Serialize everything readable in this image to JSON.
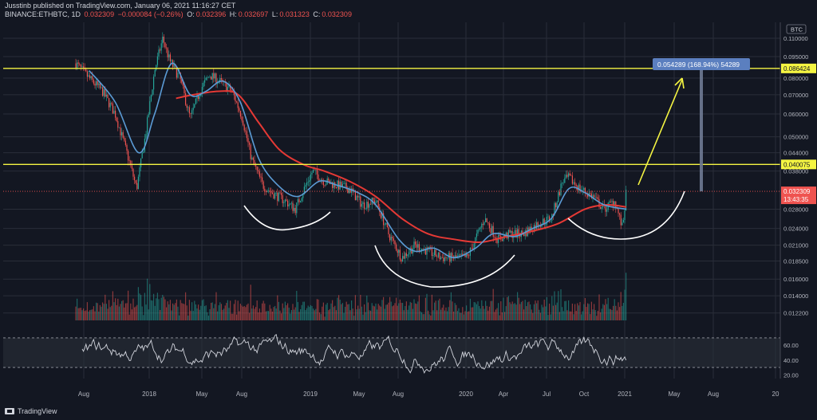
{
  "header": {
    "publisher_line": "Jusstinb published on TradingView.com, January 06, 2021 11:16:27 CET",
    "symbol": "BINANCE:ETHBTC, 1D",
    "last": "0.032309",
    "change": "−0.000084 (−0.26%)",
    "o_label": "O:",
    "o": "0.032396",
    "h_label": "H:",
    "h": "0.032697",
    "l_label": "L:",
    "l": "0.031323",
    "c_label": "C:",
    "c": "0.032309"
  },
  "footer": {
    "brand": "TradingView"
  },
  "colors": {
    "background": "#131722",
    "grid": "#2a2e39",
    "up": "#26a69a",
    "down": "#ef5350",
    "ma_fast": "#5b9bd5",
    "ma_slow": "#e53935",
    "level": "#f5f542",
    "arrow": "#f5f542",
    "curves": "#ffffff",
    "rsi": "#d1d4dc",
    "measure": "#5b7fbf"
  },
  "chart_data": {
    "type": "candlestick",
    "currency_label": "BTC",
    "x_ticks": [
      "Aug",
      "2018",
      "May",
      "Aug",
      "2019",
      "May",
      "Aug",
      "2020",
      "Apr",
      "Jul",
      "Oct",
      "2021",
      "May",
      "Aug",
      "20"
    ],
    "y_axis_log": true,
    "y_ticks": [
      "0.110000",
      "0.095000",
      "0.080000",
      "0.070000",
      "0.060000",
      "0.050000",
      "0.044000",
      "0.038000",
      "0.028000",
      "0.024000",
      "0.021000",
      "0.018500",
      "0.016000",
      "0.014000",
      "0.012200"
    ],
    "y_range": [
      0.0115,
      0.125
    ],
    "horizontal_levels": [
      {
        "price": 0.086424,
        "label": "0.086424"
      },
      {
        "price": 0.040075,
        "label": "0.040075"
      }
    ],
    "last_price": {
      "price": 0.032309,
      "label": "0.032309",
      "countdown": "13:43:35"
    },
    "measure_label": "0.054289 (168.94%) 54289",
    "price_path": [
      [
        "2017-07-01",
        0.09
      ],
      [
        "2017-08-01",
        0.08
      ],
      [
        "2017-09-01",
        0.072
      ],
      [
        "2017-10-01",
        0.06
      ],
      [
        "2017-11-01",
        0.042
      ],
      [
        "2017-11-20",
        0.033
      ],
      [
        "2017-12-10",
        0.05
      ],
      [
        "2018-01-01",
        0.085
      ],
      [
        "2018-01-20",
        0.11
      ],
      [
        "2018-02-05",
        0.092
      ],
      [
        "2018-03-01",
        0.08
      ],
      [
        "2018-03-25",
        0.058
      ],
      [
        "2018-04-20",
        0.074
      ],
      [
        "2018-05-10",
        0.082
      ],
      [
        "2018-06-01",
        0.078
      ],
      [
        "2018-07-01",
        0.072
      ],
      [
        "2018-07-25",
        0.058
      ],
      [
        "2018-08-15",
        0.042
      ],
      [
        "2018-09-10",
        0.034
      ],
      [
        "2018-10-01",
        0.032
      ],
      [
        "2018-11-01",
        0.03
      ],
      [
        "2018-11-25",
        0.028
      ],
      [
        "2018-12-20",
        0.034
      ],
      [
        "2019-01-05",
        0.038
      ],
      [
        "2019-02-01",
        0.035
      ],
      [
        "2019-03-01",
        0.034
      ],
      [
        "2019-04-01",
        0.033
      ],
      [
        "2019-05-01",
        0.029
      ],
      [
        "2019-06-01",
        0.03
      ],
      [
        "2019-07-01",
        0.023
      ],
      [
        "2019-08-01",
        0.019
      ],
      [
        "2019-09-01",
        0.021
      ],
      [
        "2019-10-01",
        0.02
      ],
      [
        "2019-11-01",
        0.019
      ],
      [
        "2019-12-01",
        0.019
      ],
      [
        "2020-01-01",
        0.019
      ],
      [
        "2020-02-10",
        0.026
      ],
      [
        "2020-03-12",
        0.022
      ],
      [
        "2020-04-10",
        0.023
      ],
      [
        "2020-05-10",
        0.023
      ],
      [
        "2020-06-15",
        0.025
      ],
      [
        "2020-07-15",
        0.026
      ],
      [
        "2020-08-10",
        0.035
      ],
      [
        "2020-08-25",
        0.036
      ],
      [
        "2020-09-20",
        0.033
      ],
      [
        "2020-10-20",
        0.031
      ],
      [
        "2020-11-15",
        0.028
      ],
      [
        "2020-12-10",
        0.03
      ],
      [
        "2020-12-28",
        0.024
      ],
      [
        "2021-01-06",
        0.0323
      ]
    ],
    "ma_fast_path": [
      [
        "2017-08-01",
        0.085
      ],
      [
        "2017-10-01",
        0.066
      ],
      [
        "2017-11-25",
        0.044
      ],
      [
        "2018-01-01",
        0.06
      ],
      [
        "2018-02-10",
        0.09
      ],
      [
        "2018-03-25",
        0.07
      ],
      [
        "2018-05-01",
        0.072
      ],
      [
        "2018-06-10",
        0.078
      ],
      [
        "2018-07-20",
        0.066
      ],
      [
        "2018-09-01",
        0.042
      ],
      [
        "2018-10-15",
        0.034
      ],
      [
        "2018-12-01",
        0.031
      ],
      [
        "2019-01-20",
        0.035
      ],
      [
        "2019-03-01",
        0.034
      ],
      [
        "2019-04-20",
        0.032
      ],
      [
        "2019-06-01",
        0.029
      ],
      [
        "2019-07-25",
        0.022
      ],
      [
        "2019-09-01",
        0.02
      ],
      [
        "2019-10-15",
        0.0205
      ],
      [
        "2019-12-01",
        0.019
      ],
      [
        "2020-01-20",
        0.0205
      ],
      [
        "2020-03-01",
        0.023
      ],
      [
        "2020-04-20",
        0.0225
      ],
      [
        "2020-06-01",
        0.024
      ],
      [
        "2020-07-15",
        0.026
      ],
      [
        "2020-08-25",
        0.033
      ],
      [
        "2020-10-01",
        0.032
      ],
      [
        "2020-11-15",
        0.029
      ],
      [
        "2021-01-06",
        0.028
      ]
    ],
    "ma_slow_path": [
      [
        "2018-02-20",
        0.068
      ],
      [
        "2018-04-01",
        0.07
      ],
      [
        "2018-06-01",
        0.072
      ],
      [
        "2018-07-15",
        0.07
      ],
      [
        "2018-09-01",
        0.056
      ],
      [
        "2018-10-20",
        0.045
      ],
      [
        "2018-12-15",
        0.04
      ],
      [
        "2019-02-01",
        0.038
      ],
      [
        "2019-04-01",
        0.035
      ],
      [
        "2019-06-01",
        0.031
      ],
      [
        "2019-08-01",
        0.026
      ],
      [
        "2019-10-01",
        0.023
      ],
      [
        "2019-12-01",
        0.022
      ],
      [
        "2020-02-01",
        0.0215
      ],
      [
        "2020-04-01",
        0.0225
      ],
      [
        "2020-06-01",
        0.0235
      ],
      [
        "2020-08-01",
        0.025
      ],
      [
        "2020-10-01",
        0.028
      ],
      [
        "2020-11-20",
        0.029
      ],
      [
        "2021-01-06",
        0.0285
      ]
    ],
    "rsi_levels": {
      "upper": 70,
      "lower": 30,
      "ticks": [
        "60.00",
        "40.00",
        "20.00"
      ],
      "range": [
        15,
        85
      ]
    }
  }
}
